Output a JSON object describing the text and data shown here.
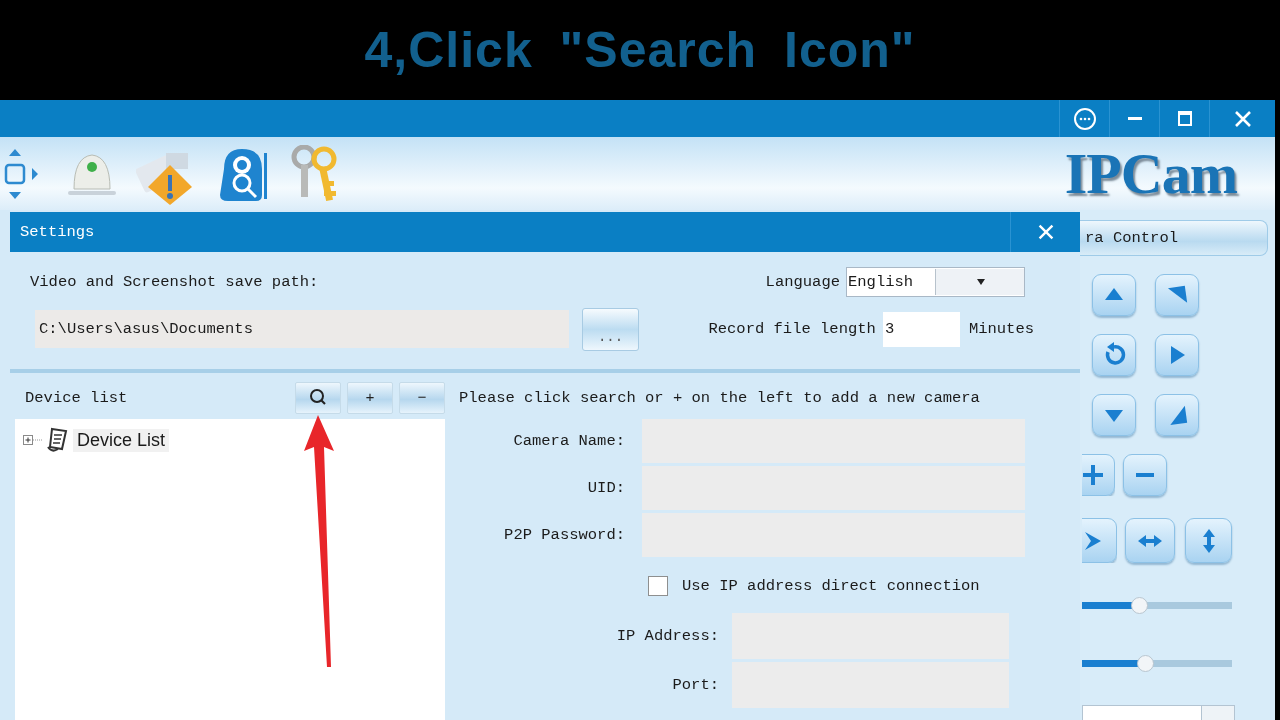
{
  "caption": "4,Click \"Search Icon\"",
  "window": {
    "buttons": [
      {
        "kind": "more"
      },
      {
        "kind": "minimize"
      },
      {
        "kind": "maximize"
      },
      {
        "kind": "close"
      }
    ]
  },
  "toolbar": {
    "tools": [
      {
        "kind": "ptz"
      },
      {
        "kind": "device"
      },
      {
        "kind": "alarm"
      },
      {
        "kind": "search_camera"
      },
      {
        "kind": "keys"
      }
    ],
    "logo": "IPCam"
  },
  "settings": {
    "title": "Settings",
    "save_path_label": "Video and Screenshot save path:",
    "save_path": "C:\\Users\\asus\\Documents",
    "browse_button": "...",
    "language_label": "Language",
    "language": "English",
    "record_length_label": "Record file length",
    "record_length": "3",
    "record_length_unit": "Minutes",
    "device_list_label": "Device list",
    "device_tools": [
      {
        "kind": "search"
      },
      {
        "kind": "add",
        "label": "+"
      },
      {
        "kind": "remove",
        "label": "−"
      }
    ],
    "tree": [
      {
        "label": "Device List",
        "expanded": false
      }
    ],
    "hint": "Please click search or + on the left to add a new camera",
    "fields": [
      {
        "label": "Camera Name:"
      },
      {
        "label": "UID:"
      },
      {
        "label": "P2P Password:"
      }
    ],
    "checkbox": {
      "label": "Use IP address direct connection",
      "checked": false
    },
    "ip_fields": [
      {
        "label": "IP Address:"
      },
      {
        "label": "Port:"
      }
    ]
  },
  "camera_control": {
    "title": "ra Control",
    "rows": [
      [
        {
          "kind": "up"
        },
        {
          "kind": "corner_up"
        }
      ],
      [
        {
          "kind": "rotate"
        },
        {
          "kind": "right"
        }
      ],
      [
        {
          "kind": "down"
        },
        {
          "kind": "corner_down"
        }
      ],
      [
        {
          "kind": "zoom_in"
        },
        {
          "kind": "zoom_out"
        }
      ],
      [
        {
          "kind": "play"
        },
        {
          "kind": "horizontal"
        },
        {
          "kind": "vertical"
        }
      ]
    ],
    "sliders": [
      {
        "level": 0.38
      },
      {
        "level": 0.42
      }
    ]
  }
}
